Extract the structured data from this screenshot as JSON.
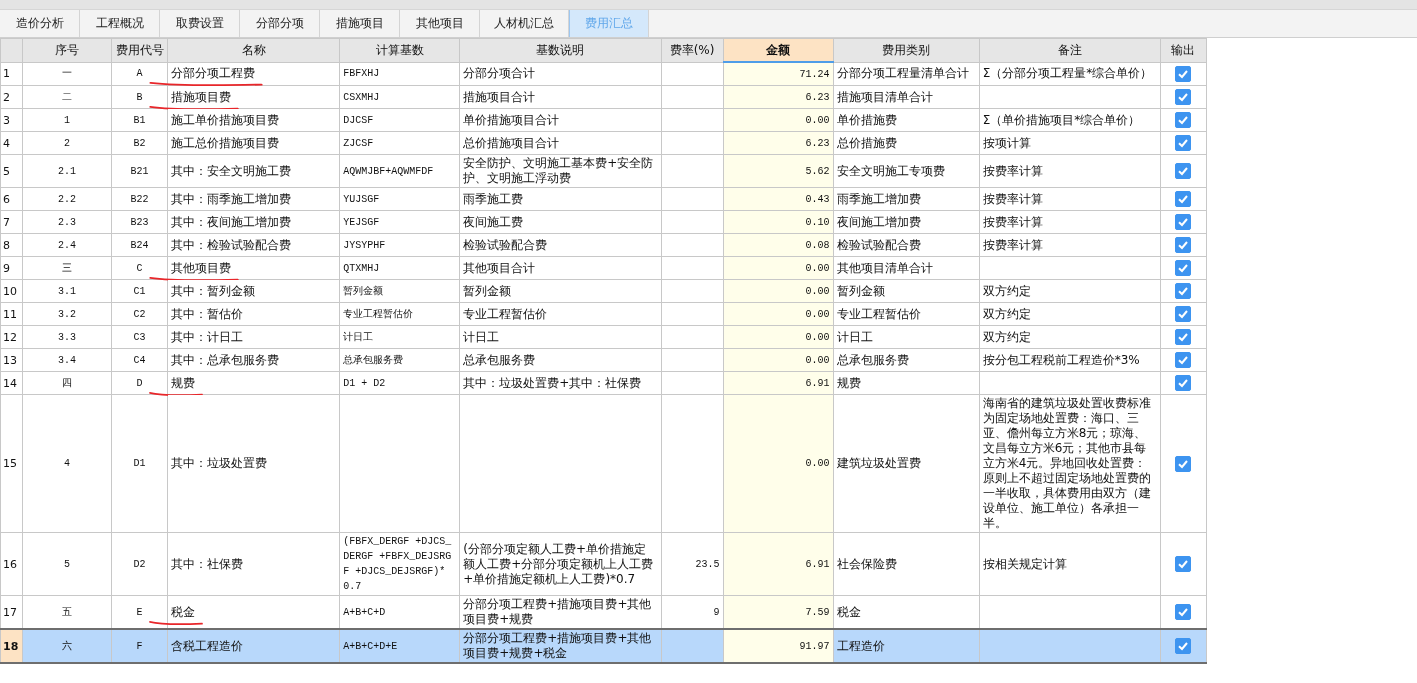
{
  "tabs": [
    {
      "label": "造价分析",
      "selected": false
    },
    {
      "label": "工程概况",
      "selected": false
    },
    {
      "label": "取费设置",
      "selected": false
    },
    {
      "label": "分部分项",
      "selected": false
    },
    {
      "label": "措施项目",
      "selected": false
    },
    {
      "label": "其他项目",
      "selected": false
    },
    {
      "label": "人材机汇总",
      "selected": false
    },
    {
      "label": "费用汇总",
      "selected": true
    }
  ],
  "table": {
    "columns": [
      {
        "label": "序号",
        "active": false
      },
      {
        "label": "费用代号",
        "active": false
      },
      {
        "label": "名称",
        "active": false
      },
      {
        "label": "计算基数",
        "active": false
      },
      {
        "label": "基数说明",
        "active": false
      },
      {
        "label": "费率(%)",
        "active": false
      },
      {
        "label": "金额",
        "active": true
      },
      {
        "label": "费用类别",
        "active": false
      },
      {
        "label": "备注",
        "active": false
      },
      {
        "label": "输出",
        "active": false
      }
    ],
    "rows": [
      {
        "num": "1",
        "seq": "一",
        "code": "A",
        "name": "分部分项工程费",
        "base": "FBFXHJ",
        "base_desc": "分部分项合计",
        "rate": "",
        "amount": "71.24",
        "category": "分部分项工程量清单合计",
        "remark": "Σ（分部分项工程量*综合单价）",
        "output": true,
        "selected": false,
        "marked": true
      },
      {
        "num": "2",
        "seq": "二",
        "code": "B",
        "name": "措施项目费",
        "base": "CSXMHJ",
        "base_desc": "措施项目合计",
        "rate": "",
        "amount": "6.23",
        "category": "措施项目清单合计",
        "remark": "",
        "output": true,
        "selected": false,
        "marked": true
      },
      {
        "num": "3",
        "seq": "1",
        "code": "B1",
        "name": "施工单价措施项目费",
        "base": "DJCSF",
        "base_desc": "单价措施项目合计",
        "rate": "",
        "amount": "0.00",
        "category": "单价措施费",
        "remark": "Σ（单价措施项目*综合单价）",
        "output": true,
        "selected": false,
        "marked": false
      },
      {
        "num": "4",
        "seq": "2",
        "code": "B2",
        "name": "施工总价措施项目费",
        "base": "ZJCSF",
        "base_desc": "总价措施项目合计",
        "rate": "",
        "amount": "6.23",
        "category": "总价措施费",
        "remark": "按项计算",
        "output": true,
        "selected": false,
        "marked": false
      },
      {
        "num": "5",
        "seq": "2.1",
        "code": "B21",
        "name": "其中：安全文明施工费",
        "base": "AQWMJBF+AQWMFDF",
        "base_desc": "安全防护、文明施工基本费+安全防护、文明施工浮动费",
        "rate": "",
        "amount": "5.62",
        "category": "安全文明施工专项费",
        "remark": "按费率计算",
        "output": true,
        "selected": false,
        "marked": false
      },
      {
        "num": "6",
        "seq": "2.2",
        "code": "B22",
        "name": "其中：雨季施工增加费",
        "base": "YUJSGF",
        "base_desc": "雨季施工费",
        "rate": "",
        "amount": "0.43",
        "category": "雨季施工增加费",
        "remark": "按费率计算",
        "output": true,
        "selected": false,
        "marked": false
      },
      {
        "num": "7",
        "seq": "2.3",
        "code": "B23",
        "name": "其中：夜间施工增加费",
        "base": "YEJSGF",
        "base_desc": "夜间施工费",
        "rate": "",
        "amount": "0.10",
        "category": "夜间施工增加费",
        "remark": "按费率计算",
        "output": true,
        "selected": false,
        "marked": false
      },
      {
        "num": "8",
        "seq": "2.4",
        "code": "B24",
        "name": "其中：检验试验配合费",
        "base": "JYSYPHF",
        "base_desc": "检验试验配合费",
        "rate": "",
        "amount": "0.08",
        "category": "检验试验配合费",
        "remark": "按费率计算",
        "output": true,
        "selected": false,
        "marked": false
      },
      {
        "num": "9",
        "seq": "三",
        "code": "C",
        "name": "其他项目费",
        "base": "QTXMHJ",
        "base_desc": "其他项目合计",
        "rate": "",
        "amount": "0.00",
        "category": "其他项目清单合计",
        "remark": "",
        "output": true,
        "selected": false,
        "marked": true
      },
      {
        "num": "10",
        "seq": "3.1",
        "code": "C1",
        "name": "其中：暂列金额",
        "base": "暂列金额",
        "base_desc": "暂列金额",
        "rate": "",
        "amount": "0.00",
        "category": "暂列金额",
        "remark": "双方约定",
        "output": true,
        "selected": false,
        "marked": false
      },
      {
        "num": "11",
        "seq": "3.2",
        "code": "C2",
        "name": "其中：暂估价",
        "base": "专业工程暂估价",
        "base_desc": "专业工程暂估价",
        "rate": "",
        "amount": "0.00",
        "category": "专业工程暂估价",
        "remark": "双方约定",
        "output": true,
        "selected": false,
        "marked": false
      },
      {
        "num": "12",
        "seq": "3.3",
        "code": "C3",
        "name": "其中：计日工",
        "base": "计日工",
        "base_desc": "计日工",
        "rate": "",
        "amount": "0.00",
        "category": "计日工",
        "remark": "双方约定",
        "output": true,
        "selected": false,
        "marked": false
      },
      {
        "num": "13",
        "seq": "3.4",
        "code": "C4",
        "name": "其中：总承包服务费",
        "base": "总承包服务费",
        "base_desc": "总承包服务费",
        "rate": "",
        "amount": "0.00",
        "category": "总承包服务费",
        "remark": "按分包工程税前工程造价*3%",
        "output": true,
        "selected": false,
        "marked": false
      },
      {
        "num": "14",
        "seq": "四",
        "code": "D",
        "name": "规费",
        "base": "D1 + D2",
        "base_desc": "其中：垃圾处置费+其中：社保费",
        "rate": "",
        "amount": "6.91",
        "category": "规费",
        "remark": "",
        "output": true,
        "selected": false,
        "marked": true
      },
      {
        "num": "15",
        "seq": "4",
        "code": "D1",
        "name": "其中：垃圾处置费",
        "base": "",
        "base_desc": "",
        "rate": "",
        "amount": "0.00",
        "category": "建筑垃圾处置费",
        "remark": "海南省的建筑垃圾处置收费标准为固定场地处置费：海口、三亚、儋州每立方米8元；琼海、文昌每立方米6元；其他市县每立方米4元。异地回收处置费：原则上不超过固定场地处置费的一半收取，具体费用由双方（建设单位、施工单位）各承担一半。",
        "output": true,
        "selected": false,
        "marked": false
      },
      {
        "num": "16",
        "seq": "5",
        "code": "D2",
        "name": "其中：社保费",
        "base": "(FBFX_DERGF +DJCS_DERGF +FBFX_DEJSRGF +DJCS_DEJSRGF)*0.7",
        "base_desc": "(分部分项定额人工费+单价措施定额人工费+分部分项定额机上人工费+单价措施定额机上人工费)*0.7",
        "rate": "23.5",
        "amount": "6.91",
        "category": "社会保险费",
        "remark": "按相关规定计算",
        "output": true,
        "selected": false,
        "marked": false
      },
      {
        "num": "17",
        "seq": "五",
        "code": "E",
        "name": "税金",
        "base": "A+B+C+D",
        "base_desc": "分部分项工程费+措施项目费+其他项目费+规费",
        "rate": "9",
        "amount": "7.59",
        "category": "税金",
        "remark": "",
        "output": true,
        "selected": false,
        "marked": true
      },
      {
        "num": "18",
        "seq": "六",
        "code": "F",
        "name": "含税工程造价",
        "base": "A+B+C+D+E",
        "base_desc": "分部分项工程费+措施项目费+其他项目费+规费+税金",
        "rate": "",
        "amount": "91.97",
        "category": "工程造价",
        "remark": "",
        "output": true,
        "selected": true,
        "marked": false
      }
    ]
  }
}
